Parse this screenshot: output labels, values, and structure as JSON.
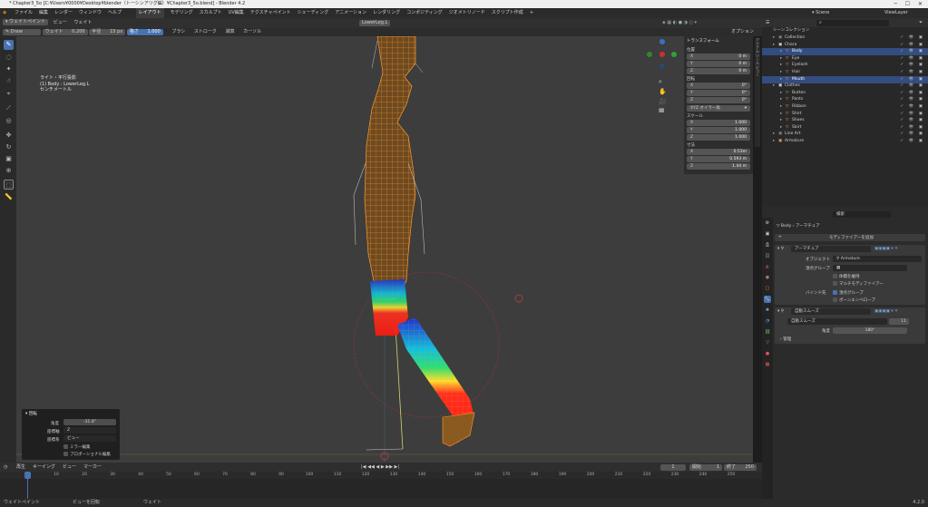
{
  "window": {
    "title": "* Chapter3_5o [C:¥Users¥0000¥Desktop¥blender（トーシンアリグ編）¥Chapter3_5o.blend] - Blender 4.2"
  },
  "menu": [
    "ファイル",
    "編集",
    "レンダー",
    "ウィンドウ",
    "ヘルプ"
  ],
  "workspaces": [
    "レイアウト",
    "モデリング",
    "スカルプト",
    "UV編集",
    "テクスチャペイント",
    "シェーディング",
    "アニメーション",
    "レンダリング",
    "コンポジティング",
    "ジオメトリノード",
    "スクリプト作成"
  ],
  "active_workspace": "レイアウト",
  "scene": "Scene",
  "view_layer": "ViewLayer",
  "viewport_header": {
    "mode": "ウェイトペイント",
    "menus": [
      "ビュー",
      "ウェイト"
    ],
    "active_bone": "LowerLeg.L",
    "options": "オプション"
  },
  "tool_settings": {
    "brush_name": "Draw",
    "weight_label": "ウェイト",
    "weight_value": "0.200",
    "radius_label": "半径",
    "radius_value": "15 px",
    "strength_label": "強さ",
    "strength_value": "1.000",
    "brush_menu": "ブラシ",
    "stroke_menu": "ストローク",
    "falloff_menu": "減衰",
    "cursor_menu": "カーソル"
  },
  "viewport_info": {
    "line1": "ライト・平行投影",
    "line2": "(1) Body : LowerLeg.L",
    "line3": "センチメートル"
  },
  "npanel": {
    "header": "トランスフォーム",
    "location": "位置",
    "loc": [
      {
        "k": "X",
        "v": "0 m"
      },
      {
        "k": "Y",
        "v": "0 m"
      },
      {
        "k": "Z",
        "v": "0 m"
      }
    ],
    "rotation": "回転",
    "rot": [
      {
        "k": "X",
        "v": "0°"
      },
      {
        "k": "Y",
        "v": "0°"
      },
      {
        "k": "Z",
        "v": "0°"
      }
    ],
    "rotation_mode": "XYZ オイラー角",
    "scale": "スケール",
    "scl": [
      {
        "k": "X",
        "v": "1.000"
      },
      {
        "k": "Y",
        "v": "1.000"
      },
      {
        "k": "Z",
        "v": "1.000"
      }
    ],
    "dimensions": "寸法",
    "dim": [
      {
        "k": "X",
        "v": "0.53m"
      },
      {
        "k": "Y",
        "v": "0.593 m"
      },
      {
        "k": "Z",
        "v": "1.44 m"
      }
    ]
  },
  "redo_panel": {
    "title": "回転",
    "angle_label": "角度",
    "angle_value": "-31.8°",
    "axis_label": "座標軸",
    "axis_value": "Z",
    "orient_label": "座標系",
    "orient_value": "ビュー",
    "mirror": "ミラー編集",
    "proportional": "プロポーショナル編集"
  },
  "timeline": {
    "menus": [
      "再生",
      "キーイング",
      "ビュー",
      "マーカー"
    ],
    "current_frame": "1",
    "start_label": "開始",
    "start": "1",
    "end_label": "終了",
    "end": "250",
    "ticks": [
      "0",
      "10",
      "20",
      "30",
      "40",
      "50",
      "60",
      "70",
      "80",
      "90",
      "100",
      "110",
      "120",
      "130",
      "140",
      "150",
      "160",
      "170",
      "180",
      "190",
      "200",
      "210",
      "220",
      "230",
      "240",
      "250"
    ]
  },
  "statusbar": {
    "left": "ウェイトペイント",
    "mid": "ビューを回転",
    "right": "ウェイト",
    "version": "4.2.0"
  },
  "outliner": {
    "root": "シーンコレクション",
    "rows": [
      {
        "indent": 1,
        "name": "Collection",
        "color": "#888",
        "sel": false
      },
      {
        "indent": 1,
        "name": "Chara",
        "color": "#ddd",
        "sel": false
      },
      {
        "indent": 2,
        "name": "Body",
        "color": "#e8a060",
        "sel": true
      },
      {
        "indent": 2,
        "name": "Eye",
        "color": "#e8a060",
        "sel": false
      },
      {
        "indent": 2,
        "name": "Eyelash",
        "color": "#e8a060",
        "sel": false
      },
      {
        "indent": 2,
        "name": "Hair",
        "color": "#e8a060",
        "sel": false
      },
      {
        "indent": 2,
        "name": "Mouth",
        "color": "#e8a060",
        "sel": true
      },
      {
        "indent": 1,
        "name": "Clothes",
        "color": "#ddd",
        "sel": false
      },
      {
        "indent": 2,
        "name": "Button",
        "color": "#e8a060",
        "sel": false
      },
      {
        "indent": 2,
        "name": "Pants",
        "color": "#e8a060",
        "sel": false
      },
      {
        "indent": 2,
        "name": "Ribbon",
        "color": "#e8a060",
        "sel": false
      },
      {
        "indent": 2,
        "name": "Shirt",
        "color": "#e8a060",
        "sel": false
      },
      {
        "indent": 2,
        "name": "Shoes",
        "color": "#e8a060",
        "sel": false
      },
      {
        "indent": 2,
        "name": "Skirt",
        "color": "#e8a060",
        "sel": false
      },
      {
        "indent": 1,
        "name": "Line Art",
        "color": "#888",
        "sel": false
      },
      {
        "indent": 1,
        "name": "Armature",
        "color": "#e8a060",
        "sel": false
      }
    ]
  },
  "properties": {
    "search_placeholder": "検索",
    "breadcrumb_obj": "Body",
    "breadcrumb_mod": "アーマチュア",
    "add_modifier": "モディファイアーを追加",
    "mod1_name": "アーマチュア",
    "object_label": "オブジェクト",
    "object_value": "Armature",
    "vgroup_label": "頂点グループ",
    "preserve_volume": "体積を維持",
    "multi_modifier": "マルチモディファイアー",
    "bind_label": "バインド先",
    "bind_vgroups": "頂点グループ",
    "bind_envelopes": "ボーンエンベロープ",
    "mod2_name": "自動スムーズ",
    "smooth_node": "自動スムーズ",
    "smooth_count": "11",
    "angle_label": "角度",
    "angle_value": "180°",
    "manage": "管理"
  }
}
